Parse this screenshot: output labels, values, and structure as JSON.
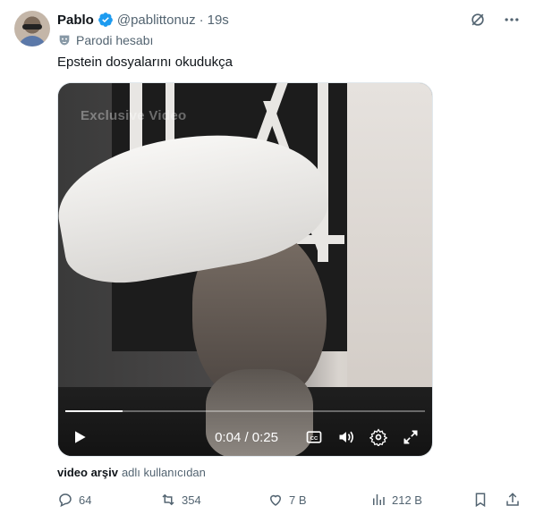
{
  "author": {
    "name": "Pablo",
    "handle": "@pablittonuz",
    "separator": "·",
    "time": "19s",
    "parody_label": "Parodi hesabı"
  },
  "tweet": {
    "text": "Epstein dosyalarını okudukça"
  },
  "video": {
    "watermark": "Exclusive Video",
    "time_display": "0:04 / 0:25",
    "progress": 0.16
  },
  "source": {
    "user": "video arşiv",
    "suffix": "adlı kullanıcıdan"
  },
  "actions": {
    "replies": "64",
    "reposts": "354",
    "likes": "7 B",
    "views": "212 B"
  },
  "colors": {
    "verified": "#1d9bf0",
    "muted_text": "#536471",
    "primary_text": "#0f1419"
  }
}
